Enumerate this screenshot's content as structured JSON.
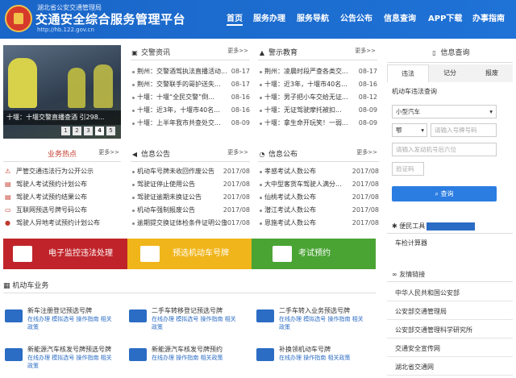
{
  "header": {
    "org": "湖北省公安交通管理局",
    "title": "交通安全综合服务管理平台",
    "url": "http://hb.122.gov.cn",
    "nav": [
      "首页",
      "服务办理",
      "服务导航",
      "公告公布",
      "信息查询",
      "APP下载",
      "办事指南"
    ]
  },
  "banner": {
    "caption": "十堰：十堰交警直播查酒 引298...",
    "pages": [
      "1",
      "2",
      "3",
      "4",
      "5"
    ]
  },
  "news": {
    "title": "交警资讯",
    "more": "更多>>",
    "items": [
      {
        "t": "荆州：交警酒驾执法直播活动...",
        "d": "08-17"
      },
      {
        "t": "荆州：交警联手的哥护送失...",
        "d": "08-17"
      },
      {
        "t": "十堰：十堰“全民交警”倒...",
        "d": "08-16"
      },
      {
        "t": "十堰：近3年，十堰市40名...",
        "d": "08-16"
      },
      {
        "t": "十堰：上半年我市共查处交...",
        "d": "08-09"
      }
    ]
  },
  "warn": {
    "title": "警示教育",
    "more": "更多>>",
    "items": [
      {
        "t": "荆州：凌晨时段严查各类交...",
        "d": "08-17"
      },
      {
        "t": "十堰：近3年，十堰市40名...",
        "d": "08-16"
      },
      {
        "t": "十堰：男子把小车交给无证...",
        "d": "08-12"
      },
      {
        "t": "十堰：无证驾驶摩托被扣...",
        "d": "08-09"
      },
      {
        "t": "十堰：拿生命开玩笑！一弱...",
        "d": "08-09"
      }
    ]
  },
  "hot": {
    "title": "业务热点",
    "more": "更多>>",
    "items": [
      "严管交通违法行为公开公示",
      "驾驶人考试预约计划公布",
      "驾驶人考试预约结果公布",
      "互联网预选号牌号码公布",
      "驾驶人异地考试预约计划公布"
    ]
  },
  "info_notice": {
    "title": "信息公告",
    "more": "更多>>",
    "items": [
      {
        "t": "机动车号牌未收回作废公告",
        "d": "2017/08"
      },
      {
        "t": "驾驶证停止使用公告",
        "d": "2017/08"
      },
      {
        "t": "驾驶证逾期未换证公告",
        "d": "2017/08"
      },
      {
        "t": "机动车强制报废公告",
        "d": "2017/08"
      },
      {
        "t": "逾期提交换证体检条件证明公告",
        "d": "2017/08"
      }
    ]
  },
  "info_pub": {
    "title": "信息公布",
    "more": "更多>>",
    "items": [
      {
        "t": "孝感考试人数公布",
        "d": "2017/08"
      },
      {
        "t": "大中型客货车驾驶人满分...",
        "d": "2017/08"
      },
      {
        "t": "仙桃考试人数公布",
        "d": "2017/08"
      },
      {
        "t": "潜江考试人数公布",
        "d": "2017/08"
      },
      {
        "t": "恩施考试人数公布",
        "d": "2017/08"
      }
    ]
  },
  "query": {
    "title": "信息查询",
    "tabs": [
      "违法",
      "记分",
      "报废"
    ],
    "subtitle": "机动车违法查询",
    "vehicle_type": "小型汽车",
    "plate_prefix": "鄂",
    "plate_ph": "请输入号牌号码",
    "engine_ph": "请输入发动机号后六位",
    "captcha_ph": "验证码",
    "button": "查询"
  },
  "convenience": {
    "title": "便民工具",
    "item": "车检计算器"
  },
  "links": {
    "title": "友情链接",
    "items": [
      "中华人民共和国公安部",
      "公安部交通管理局",
      "公安部交通管理科学研究所",
      "交通安全宣传网",
      "湖北省交通网"
    ]
  },
  "bars": [
    {
      "label": "电子监控违法处理",
      "color": "#c0242a"
    },
    {
      "label": "预选机动车号牌",
      "color": "#f0b51a"
    },
    {
      "label": "考试预约",
      "color": "#4aa434"
    }
  ],
  "vehicle_biz": {
    "title": "机动车业务",
    "items": [
      {
        "t": "新车注册登记预选号牌",
        "l": "在线办理 模拟选号 操作指南 相关",
        "l2": "政策"
      },
      {
        "t": "二手车转移登记预选号牌",
        "l": "在线办理 模拟选号 操作指南 相关",
        "l2": "政策"
      },
      {
        "t": "二手车转入业务预选号牌",
        "l": "在线办理 模拟选号 操作指南 相关",
        "l2": "政策"
      },
      {
        "t": "新能源汽车核发号牌预选号牌",
        "l": "在线办理 模拟选号 操作指南 相关",
        "l2": "政策"
      },
      {
        "t": "新能源汽车核发号牌预约",
        "l": "在线办理 操作指南 相关政策",
        "l2": ""
      },
      {
        "t": "补换领机动车号牌",
        "l": "在线办理 操作指南 相关政策",
        "l2": ""
      }
    ]
  }
}
